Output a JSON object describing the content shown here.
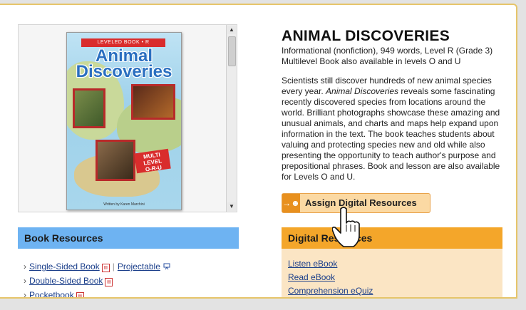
{
  "book": {
    "title": "ANIMAL DISCOVERIES",
    "meta_line1": "Informational (nonfiction), 949 words, Level R (Grade 3)",
    "meta_line2": "Multilevel Book also available in levels O and U",
    "description_pre": "Scientists still discover hundreds of new animal species every year. ",
    "description_italic": "Animal Discoveries",
    "description_post": " reveals some fascinating recently discovered species from locations around the world. Brilliant photographs showcase these amazing and unusual animals, and charts and maps help expand upon information in the text. The book teaches students about valuing and protecting species new and old while also presenting the opportunity to teach author's purpose and prepositional phrases. Book and lesson are also available for Levels O and U."
  },
  "cover": {
    "banner": "LEVELED BOOK • R",
    "title_line1": "Animal",
    "title_line2": "Discoveries",
    "badge_line1": "MULTI",
    "badge_line2": "LEVEL",
    "badge_line3": "O-R-U",
    "footer": "Written by Karen Marchini"
  },
  "assign_button": {
    "label": "Assign Digital Resources"
  },
  "book_resources": {
    "heading": "Book Resources",
    "items": [
      {
        "label": "Single-Sided Book",
        "secondary": "Projectable"
      },
      {
        "label": "Double-Sided Book"
      },
      {
        "label": "Pocketbook"
      }
    ]
  },
  "digital_resources": {
    "heading": "Digital Resources",
    "items": [
      {
        "label": "Listen eBook"
      },
      {
        "label": "Read eBook"
      },
      {
        "label": "Comprehension eQuiz"
      }
    ]
  },
  "colors": {
    "book_resources_header": "#6eb3f2",
    "digital_resources_header": "#f4a62a",
    "digital_resources_body": "#fbe5c4",
    "assign_button_bg": "#fbd9a3",
    "frame_border": "#e6c56a",
    "link": "#1a3e8a"
  }
}
